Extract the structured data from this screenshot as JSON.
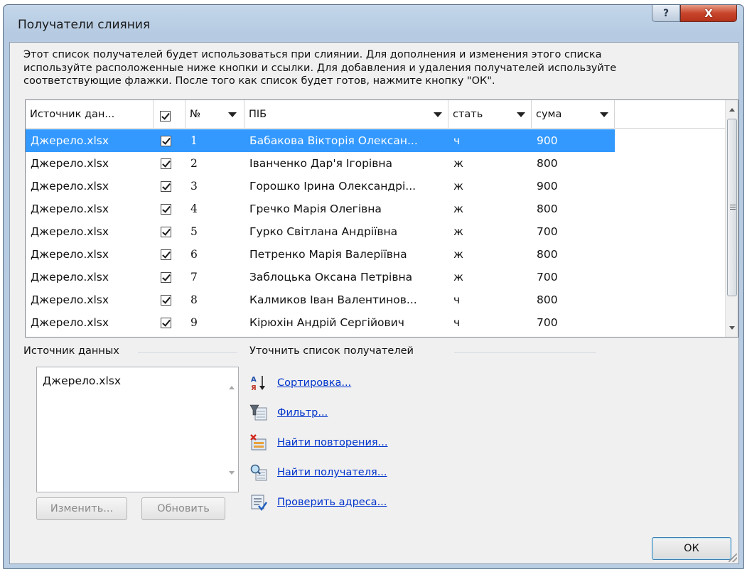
{
  "window": {
    "title": "Получатели слияния",
    "help_label": "?",
    "close_label": "X"
  },
  "description": {
    "lines": [
      "Этот список получателей будет использоваться при слиянии. Для дополнения и изменения этого списка",
      "используйте расположенные ниже кнопки и ссылки. Для добавления и удаления получателей используйте",
      "соответствующие флажки. После того как список будет готов, нажмите кнопку \"ОК\"."
    ]
  },
  "grid": {
    "headers": {
      "source": "Источник дан...",
      "number": "№",
      "name": "ПІБ",
      "gender": "стать",
      "sum": "сума"
    },
    "rows": [
      {
        "source": "Джерело.xlsx",
        "checked": true,
        "number": "1",
        "name": "Бабакова Вікторія Олексан...",
        "gender": "ч",
        "sum": "900"
      },
      {
        "source": "Джерело.xlsx",
        "checked": true,
        "number": "2",
        "name": "Іванченко Дар'я Ігорівна",
        "gender": "ж",
        "sum": "800"
      },
      {
        "source": "Джерело.xlsx",
        "checked": true,
        "number": "3",
        "name": "Горошко Ірина Олександрі...",
        "gender": "ж",
        "sum": "900"
      },
      {
        "source": "Джерело.xlsx",
        "checked": true,
        "number": "4",
        "name": "Гречко Марія Олегівна",
        "gender": "ж",
        "sum": "800"
      },
      {
        "source": "Джерело.xlsx",
        "checked": true,
        "number": "5",
        "name": "Гурко Світлана Андріївна",
        "gender": "ж",
        "sum": "700"
      },
      {
        "source": "Джерело.xlsx",
        "checked": true,
        "number": "6",
        "name": "Петренко Марія Валеріївна",
        "gender": "ж",
        "sum": "800"
      },
      {
        "source": "Джерело.xlsx",
        "checked": true,
        "number": "7",
        "name": "Заблоцька Оксана Петрівна",
        "gender": "ж",
        "sum": "700"
      },
      {
        "source": "Джерело.xlsx",
        "checked": true,
        "number": "8",
        "name": "Калмиков Іван Валентинов...",
        "gender": "ч",
        "sum": "800"
      },
      {
        "source": "Джерело.xlsx",
        "checked": true,
        "number": "9",
        "name": "Кірюхін Андрій Сергійович",
        "gender": "ч",
        "sum": "700"
      }
    ],
    "selected_row": 0
  },
  "data_source": {
    "label": "Источник данных",
    "items": [
      "Джерело.xlsx"
    ],
    "edit_button": "Изменить...",
    "refresh_button": "Обновить"
  },
  "refine": {
    "label": "Уточнить список получателей",
    "links": [
      {
        "label": "Сортировка...",
        "icon": "sort-az-icon"
      },
      {
        "label": "Фильтр...",
        "icon": "filter-icon"
      },
      {
        "label": "Найти повторения...",
        "icon": "find-duplicates-icon"
      },
      {
        "label": "Найти получателя...",
        "icon": "find-recipient-icon"
      },
      {
        "label": "Проверить адреса...",
        "icon": "validate-addresses-icon"
      }
    ]
  },
  "ok_button": "ОК",
  "colors": {
    "selection": "#3399ff",
    "link": "#0033cc",
    "close_button": "#c8462c"
  }
}
